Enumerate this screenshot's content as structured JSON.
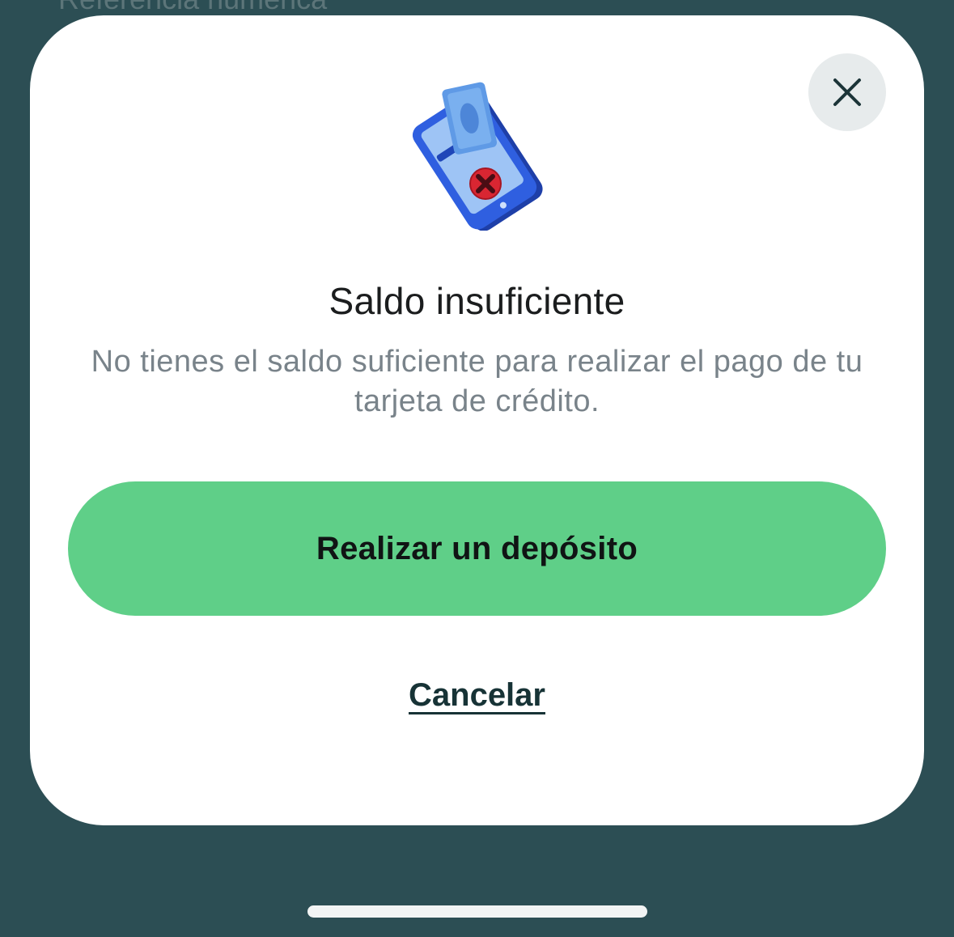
{
  "background": {
    "peek_text": "Referencia numérica",
    "color": "#2c4e54"
  },
  "modal": {
    "close_icon": "close-icon",
    "illustration_icon": "phone-money-error-icon",
    "title": "Saldo insuficiente",
    "message": "No tienes el saldo suficiente para realizar el pago de tu tarjeta de crédito.",
    "primary_button_label": "Realizar un depósito",
    "secondary_link_label": "Cancelar",
    "accent_color": "#5fcf88"
  }
}
